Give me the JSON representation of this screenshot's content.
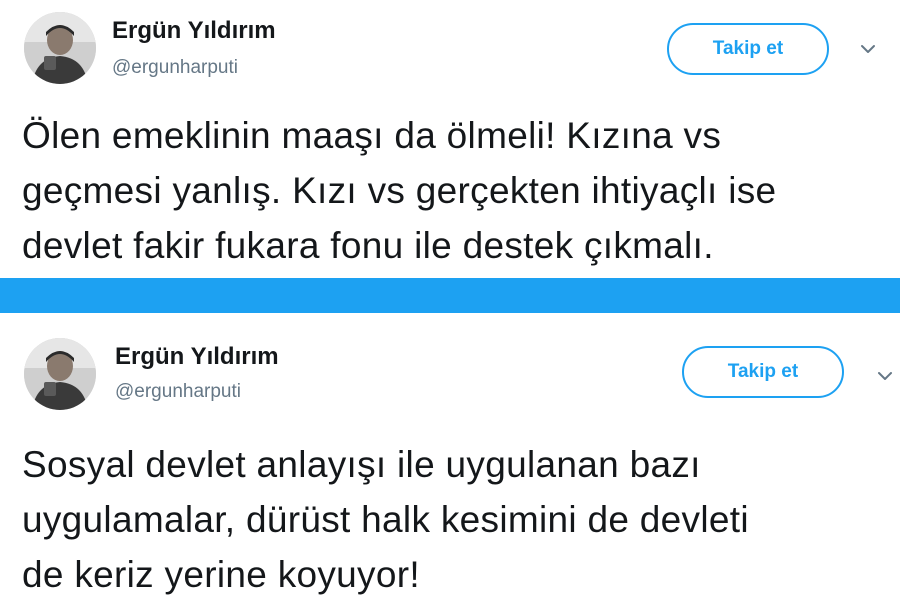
{
  "tweets": [
    {
      "author": {
        "name": "Ergün Yıldırım",
        "handle": "@ergunharputi"
      },
      "follow_label": "Takip et",
      "text_lines": [
        "Ölen emeklinin maaşı da ölmeli! Kızına vs",
        "geçmesi yanlış. Kızı vs gerçekten ihtiyaçlı ise",
        "devlet fakir fukara fonu ile destek çıkmalı."
      ]
    },
    {
      "author": {
        "name": "Ergün Yıldırım",
        "handle": "@ergunharputi"
      },
      "follow_label": "Takip et",
      "text_lines": [
        "Sosyal devlet anlayışı ile uygulanan bazı",
        "uygulamalar, dürüst halk kesimini de devleti",
        "de keriz yerine koyuyor!"
      ]
    }
  ],
  "icons": {
    "avatar": "avatar-photo",
    "menu": "chevron-down-icon"
  },
  "colors": {
    "accent": "#1da1f2",
    "text": "#14171a",
    "secondary_text": "#657786",
    "divider": "#1da1f2"
  }
}
